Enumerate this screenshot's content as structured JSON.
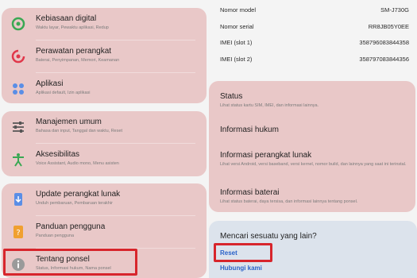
{
  "left_cards": [
    {
      "items": [
        {
          "title": "Kebiasaan digital",
          "subtitle": "Waktu layar, Pewaktu aplikasi, Redup",
          "icon": "digital-wellbeing-icon",
          "color": "#3aa853"
        },
        {
          "title": "Perawatan perangkat",
          "subtitle": "Baterai, Penyimpanan, Memori, Keamanan",
          "icon": "device-care-icon",
          "color": "#e0374a"
        },
        {
          "title": "Aplikasi",
          "subtitle": "Aplikasi default, Izin aplikasi",
          "icon": "apps-icon",
          "color": "#5a8ee6"
        }
      ]
    },
    {
      "items": [
        {
          "title": "Manajemen umum",
          "subtitle": "Bahasa dan input, Tanggal dan waktu, Reset",
          "icon": "sliders-icon",
          "color": "#555555"
        },
        {
          "title": "Aksesibilitas",
          "subtitle": "Voice Assistant, Audio mono, Menu asisten",
          "icon": "accessibility-icon",
          "color": "#3aa853"
        }
      ]
    },
    {
      "items": [
        {
          "title": "Update perangkat lunak",
          "subtitle": "Unduh pembaruan, Pembaruan terakhir",
          "icon": "software-update-icon",
          "color": "#5a8ee6"
        },
        {
          "title": "Panduan pengguna",
          "subtitle": "Panduan pengguna",
          "icon": "user-manual-icon",
          "color": "#f0a030"
        },
        {
          "title": "Tentang ponsel",
          "subtitle": "Status, Informasi hukum, Nama ponsel",
          "icon": "info-icon",
          "color": "#9a9a9a"
        }
      ]
    }
  ],
  "device_info": [
    {
      "label": "Nomor model",
      "value": "SM-J730G"
    },
    {
      "label": "Nomor serial",
      "value": "RR8JB05Y0EE"
    },
    {
      "label": "IMEI (slot 1)",
      "value": "358796083844358"
    },
    {
      "label": "IMEI (slot 2)",
      "value": "358797083844356"
    }
  ],
  "right_items": [
    {
      "title": "Status",
      "subtitle": "Lihat status kartu SIM, IMEI, dan informasi lainnya."
    },
    {
      "title": "Informasi hukum",
      "subtitle": ""
    },
    {
      "title": "Informasi perangkat lunak",
      "subtitle": "Lihat versi Android, versi baseband, versi kernel, nomor build, dan lainnya yang saat ini terinstal."
    },
    {
      "title": "Informasi baterai",
      "subtitle": "Lihat status baterai, daya tersisa, dan informasi lainnya tentang ponsel."
    }
  ],
  "search_panel": {
    "heading": "Mencari sesuatu yang lain?",
    "links": [
      "Reset",
      "Hubungi kami"
    ]
  }
}
